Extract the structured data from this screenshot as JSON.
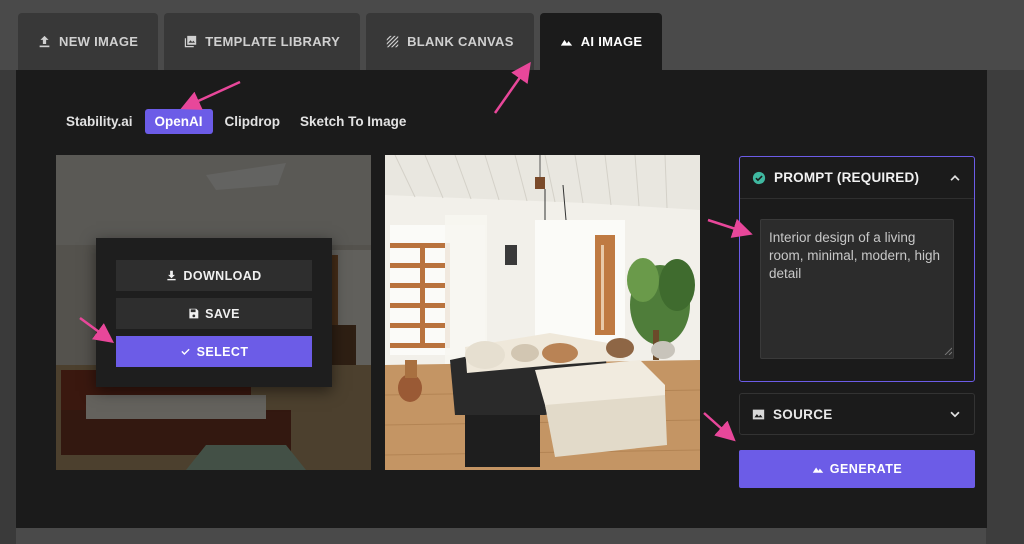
{
  "top_tabs": [
    {
      "label": "NEW IMAGE",
      "icon": "upload-icon",
      "active": false
    },
    {
      "label": "TEMPLATE LIBRARY",
      "icon": "gallery-icon",
      "active": false
    },
    {
      "label": "BLANK CANVAS",
      "icon": "hatch-icon",
      "active": false
    },
    {
      "label": "AI IMAGE",
      "icon": "mountain-icon",
      "active": true
    }
  ],
  "providers": [
    "Stability.ai",
    "OpenAI",
    "Clipdrop",
    "Sketch To Image"
  ],
  "active_provider": "OpenAI",
  "image_menu": {
    "download": "DOWNLOAD",
    "save": "SAVE",
    "select": "SELECT"
  },
  "prompt": {
    "title": "PROMPT (REQUIRED)",
    "value": "Interior design of a living room, minimal, modern, high detail"
  },
  "source": {
    "title": "SOURCE"
  },
  "generate": {
    "label": "GENERATE"
  },
  "colors": {
    "accent": "#6c5ce7",
    "panel": "#1b1b1b",
    "check": "#3fb8a0",
    "annotation": "#e8479a"
  }
}
